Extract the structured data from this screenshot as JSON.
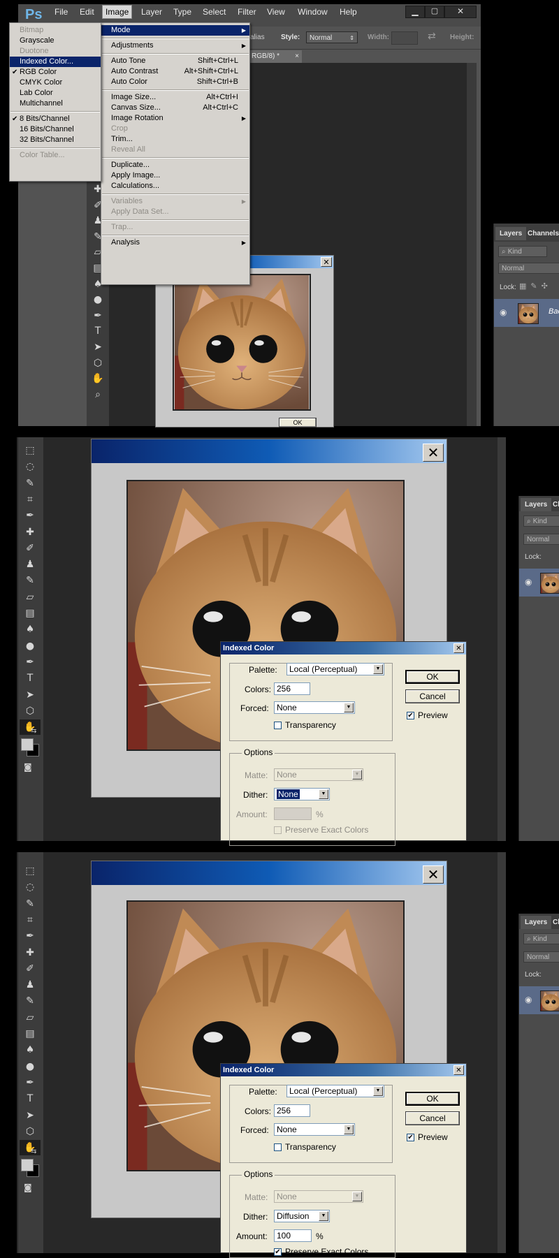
{
  "app": {
    "logo": "Ps",
    "menubar": [
      "File",
      "Edit",
      "Image",
      "Layer",
      "Type",
      "Select",
      "Filter",
      "View",
      "Window",
      "Help"
    ],
    "open_menu": "Image",
    "window_controls": [
      "minimize-icon",
      "maximize-icon",
      "close-icon"
    ]
  },
  "options_bar": {
    "partial_label": "alias",
    "style_label": "Style:",
    "style_value": "Normal",
    "width_label": "Width:",
    "height_label": "Height:"
  },
  "doc_tab": {
    "title": "RGB/8) *",
    "close": "×"
  },
  "image_menu": [
    {
      "label": "Mode",
      "submenu": true,
      "highlight": true
    },
    {
      "sep": true
    },
    {
      "label": "Adjustments",
      "submenu": true
    },
    {
      "sep": true
    },
    {
      "label": "Auto Tone",
      "shortcut": "Shift+Ctrl+L"
    },
    {
      "label": "Auto Contrast",
      "shortcut": "Alt+Shift+Ctrl+L"
    },
    {
      "label": "Auto Color",
      "shortcut": "Shift+Ctrl+B"
    },
    {
      "sep": true
    },
    {
      "label": "Image Size...",
      "shortcut": "Alt+Ctrl+I"
    },
    {
      "label": "Canvas Size...",
      "shortcut": "Alt+Ctrl+C"
    },
    {
      "label": "Image Rotation",
      "submenu": true
    },
    {
      "label": "Crop",
      "disabled": true
    },
    {
      "label": "Trim..."
    },
    {
      "label": "Reveal All",
      "disabled": true
    },
    {
      "sep": true
    },
    {
      "label": "Duplicate..."
    },
    {
      "label": "Apply Image..."
    },
    {
      "label": "Calculations..."
    },
    {
      "sep": true
    },
    {
      "label": "Variables",
      "submenu": true,
      "disabled": true
    },
    {
      "label": "Apply Data Set...",
      "disabled": true
    },
    {
      "sep": true
    },
    {
      "label": "Trap...",
      "disabled": true
    },
    {
      "sep": true
    },
    {
      "label": "Analysis",
      "submenu": true
    }
  ],
  "mode_menu": [
    {
      "label": "Bitmap",
      "disabled": true
    },
    {
      "label": "Grayscale"
    },
    {
      "label": "Duotone",
      "disabled": true
    },
    {
      "label": "Indexed Color...",
      "highlight": true
    },
    {
      "label": "RGB Color",
      "checked": true
    },
    {
      "label": "CMYK Color"
    },
    {
      "label": "Lab Color"
    },
    {
      "label": "Multichannel"
    },
    {
      "sep": true
    },
    {
      "label": "8 Bits/Channel",
      "checked": true
    },
    {
      "label": "16 Bits/Channel"
    },
    {
      "label": "32 Bits/Channel"
    },
    {
      "sep": true
    },
    {
      "label": "Color Table...",
      "disabled": true
    }
  ],
  "small_window": {
    "ok": "OK"
  },
  "layers_panel": {
    "tabs": [
      "Layers",
      "Channels"
    ],
    "kind": "Kind",
    "blend": "Normal",
    "lock": "Lock:",
    "layer_name": "Bac"
  },
  "dialog1": {
    "title": "Indexed Color",
    "palette_label": "Palette:",
    "palette_value": "Local (Perceptual)",
    "colors_label": "Colors:",
    "colors_value": "256",
    "forced_label": "Forced:",
    "forced_value": "None",
    "transparency_label": "Transparency",
    "options_label": "Options",
    "matte_label": "Matte:",
    "matte_value": "None",
    "dither_label": "Dither:",
    "dither_value": "None",
    "amount_label": "Amount:",
    "amount_value": "",
    "percent": "%",
    "preserve_label": "Preserve Exact Colors",
    "ok": "OK",
    "cancel": "Cancel",
    "preview": "Preview"
  },
  "dialog2": {
    "title": "Indexed Color",
    "palette_label": "Palette:",
    "palette_value": "Local (Perceptual)",
    "colors_label": "Colors:",
    "colors_value": "256",
    "forced_label": "Forced:",
    "forced_value": "None",
    "transparency_label": "Transparency",
    "options_label": "Options",
    "matte_label": "Matte:",
    "matte_value": "None",
    "dither_label": "Dither:",
    "dither_value": "Diffusion",
    "amount_label": "Amount:",
    "amount_value": "100",
    "percent": "%",
    "preserve_label": "Preserve Exact Colors",
    "ok": "OK",
    "cancel": "Cancel",
    "preview": "Preview"
  },
  "panel_tabs_short": [
    "Layers",
    "Ch"
  ],
  "colors": {
    "menu_highlight": "#0a246a",
    "title_start": "#0a246a",
    "title_end": "#a6caf0",
    "ps_dark": "#282828"
  }
}
